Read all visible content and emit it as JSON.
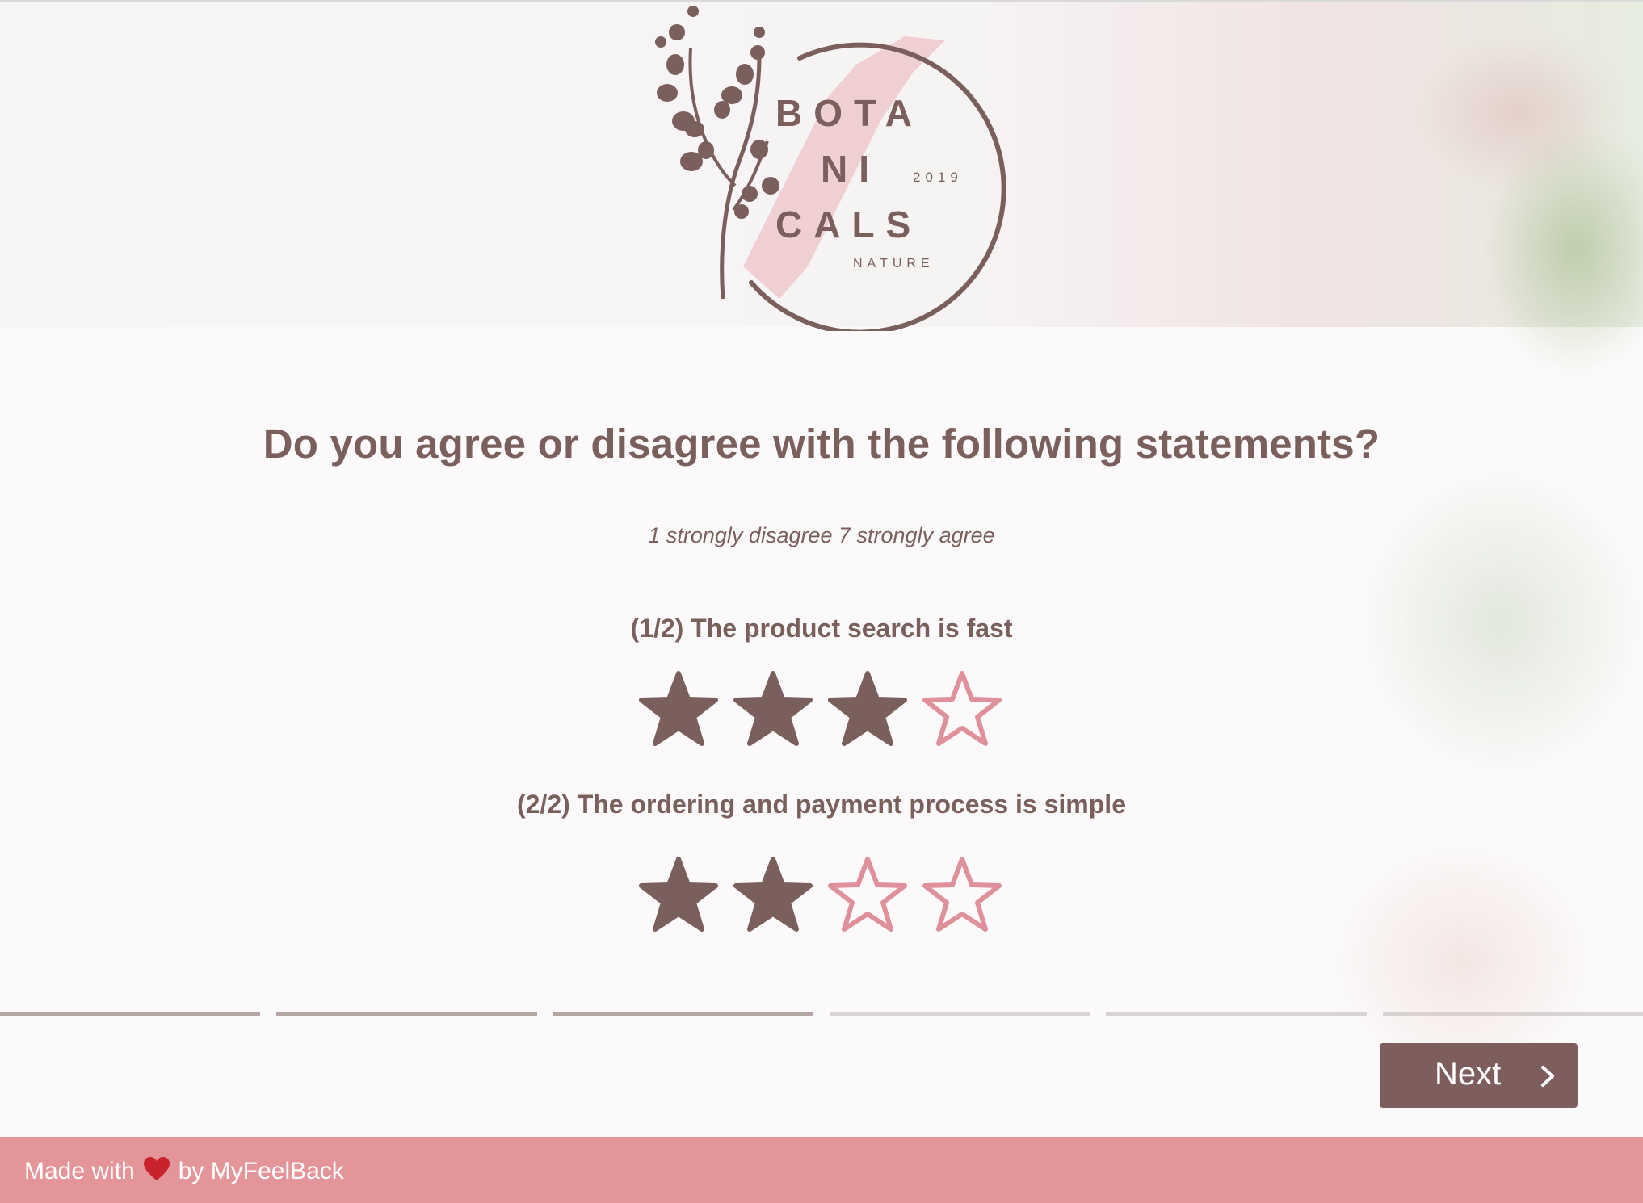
{
  "logo": {
    "line1": "BOTA",
    "line2": "NI",
    "line3": "CALS",
    "year": "2019",
    "tagline": "NATURE"
  },
  "survey": {
    "question": "Do you agree or disagree with the following statements?",
    "scale_hint": "1 strongly disagree 7 strongly agree",
    "statements": [
      {
        "label": "(1/2) The product search is fast",
        "rating": 3,
        "max": 4
      },
      {
        "label": "(2/2) The ordering and payment process is simple",
        "rating": 2,
        "max": 4
      }
    ]
  },
  "progress": {
    "total_segments": 6,
    "completed_segments": 3
  },
  "nav": {
    "next_label": "Next",
    "next_icon": "chevron-right-icon"
  },
  "footer": {
    "made_with": "Made with",
    "by": "by MyFeelBack",
    "heart_icon": "heart-icon"
  },
  "colors": {
    "primary": "#7a5f5d",
    "accent_pink": "#e3959a",
    "star_empty": "#e0909a",
    "heart": "#c8232c"
  }
}
